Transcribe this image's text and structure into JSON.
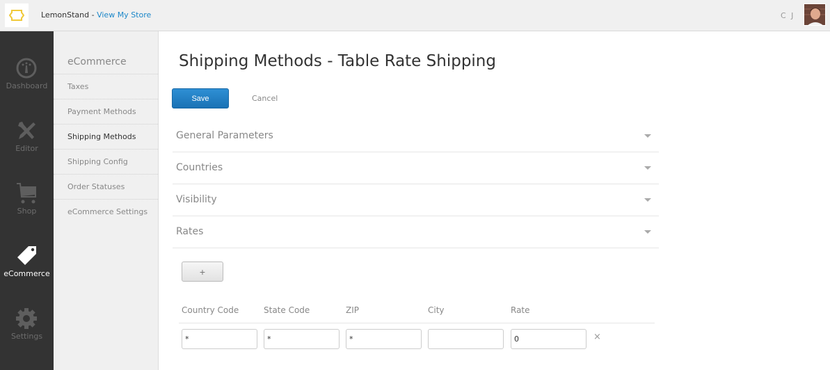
{
  "topbar": {
    "brand": "LemonStand",
    "separator": " - ",
    "store_link": "View My Store",
    "user_initials": "C J"
  },
  "leftnav": {
    "items": [
      {
        "label": "Dashboard",
        "icon": "dashboard-gauge-icon"
      },
      {
        "label": "Editor",
        "icon": "editor-tools-icon"
      },
      {
        "label": "Shop",
        "icon": "shop-cart-icon"
      },
      {
        "label": "eCommerce",
        "icon": "ecommerce-tag-icon",
        "active": true
      },
      {
        "label": "Settings",
        "icon": "settings-gear-icon"
      }
    ]
  },
  "subnav": {
    "title": "eCommerce",
    "items": [
      {
        "label": "Taxes"
      },
      {
        "label": "Payment Methods"
      },
      {
        "label": "Shipping Methods",
        "active": true
      },
      {
        "label": "Shipping Config"
      },
      {
        "label": "Order Statuses"
      },
      {
        "label": "eCommerce Settings"
      }
    ]
  },
  "main": {
    "title": "Shipping Methods - Table Rate Shipping",
    "save_label": "Save",
    "cancel_label": "Cancel",
    "sections": [
      {
        "label": "General Parameters"
      },
      {
        "label": "Countries"
      },
      {
        "label": "Visibility"
      },
      {
        "label": "Rates"
      }
    ],
    "add_label": "+",
    "rates_table": {
      "columns": [
        "Country Code",
        "State Code",
        "ZIP",
        "City",
        "Rate"
      ],
      "rows": [
        {
          "country": "*",
          "state": "*",
          "zip": "*",
          "city": "",
          "rate": "0"
        }
      ],
      "delete_label": "×"
    }
  }
}
